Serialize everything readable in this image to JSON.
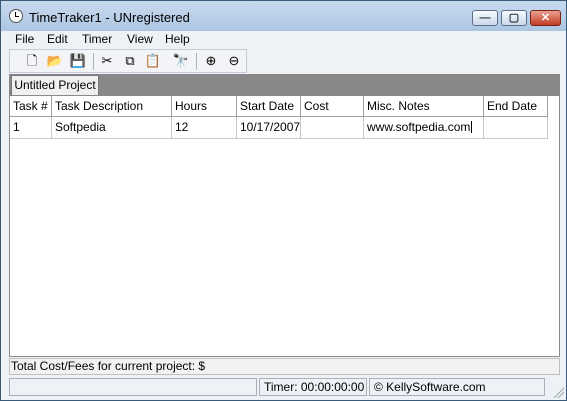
{
  "window": {
    "title": "TimeTraker1 - UNregistered",
    "min_glyph": "—",
    "max_glyph": "▢",
    "close_glyph": "✕"
  },
  "menu": [
    "File",
    "Edit",
    "Timer",
    "View",
    "Help"
  ],
  "toolbar": [
    {
      "name": "new-icon",
      "glyph": "🗋"
    },
    {
      "name": "open-folder-icon",
      "glyph": "📂"
    },
    {
      "name": "save-icon",
      "glyph": "💾"
    },
    {
      "name": "cut-icon",
      "glyph": "✂"
    },
    {
      "name": "copy-icon",
      "glyph": "⧉"
    },
    {
      "name": "paste-icon",
      "glyph": "📋"
    },
    {
      "name": "find-icon",
      "glyph": "🔭"
    },
    {
      "name": "add-task-icon",
      "glyph": "⊕"
    },
    {
      "name": "remove-task-icon",
      "glyph": "⊖"
    }
  ],
  "tab": {
    "label": "Untitled Project"
  },
  "grid": {
    "columns": [
      "Task #",
      "Task Description",
      "Hours",
      "Start Date",
      "Cost",
      "Misc. Notes",
      "End Date"
    ],
    "rows": [
      [
        "1",
        "Softpedia",
        "12",
        "10/17/2007",
        "",
        "www.softpedia.com",
        ""
      ]
    ]
  },
  "total": {
    "text": "Total Cost/Fees for current project: $"
  },
  "status": {
    "timer": "Timer: 00:00:00:00",
    "company": "© KellySoftware.com"
  }
}
